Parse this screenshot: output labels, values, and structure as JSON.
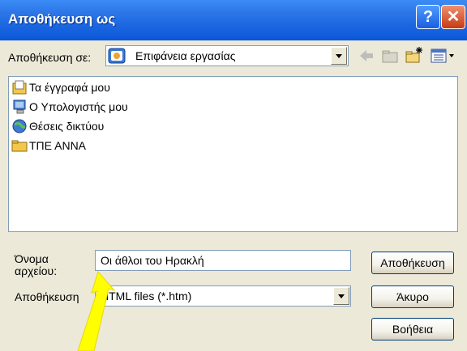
{
  "window": {
    "title": "Αποθήκευση ως",
    "help_glyph": "?",
    "close_glyph": "✕",
    "titlebar_color": "#0a56d8"
  },
  "toolbar": {
    "save_in_label": "Αποθήκευση σε:",
    "save_in_value": "Επιφάνεια εργασίας",
    "save_in_icon": "desktop-icon",
    "tools": [
      "back-arrow-icon",
      "up-folder-icon",
      "new-folder-icon",
      "view-menu-icon"
    ]
  },
  "file_list": {
    "items": [
      {
        "label": "Τα έγγραφά μου",
        "icon": "my-documents-icon"
      },
      {
        "label": "Ο Υπολογιστής μου",
        "icon": "my-computer-icon"
      },
      {
        "label": "Θέσεις δικτύου",
        "icon": "network-places-icon"
      },
      {
        "label": "ΤΠΕ ΑΝΝΑ",
        "icon": "folder-icon"
      }
    ]
  },
  "form": {
    "filename_label": "Όνομα αρχείου:",
    "filename_value": "Οι άθλοι του Ηρακλή",
    "saveas_label": "Αποθήκευση",
    "saveas_value": "HTML files (*.htm)"
  },
  "buttons": {
    "save": "Αποθήκευση",
    "cancel": "Άκυρο",
    "help": "Βοήθεια"
  },
  "annotation": {
    "arrow_color": "#ffff00",
    "arrow_icon": "yellow-arrow"
  }
}
